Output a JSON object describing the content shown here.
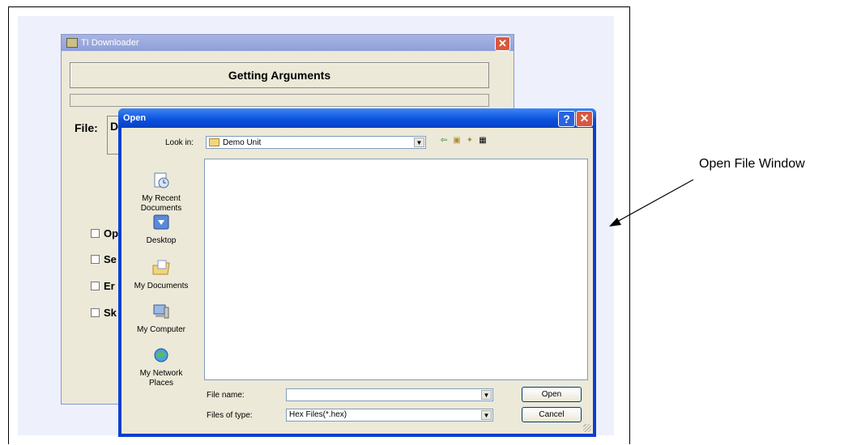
{
  "ti_window": {
    "title": "TI Downloader",
    "heading": "Getting Arguments",
    "file_label": "File:",
    "file_value_partial": "D",
    "close_glyph": "✕",
    "options": [
      "Op",
      "Se",
      "Er",
      "Sk"
    ]
  },
  "open_dialog": {
    "title": "Open",
    "help_glyph": "?",
    "close_glyph": "✕",
    "look_in_label": "Look in:",
    "look_in_value": "Demo Unit",
    "places": [
      {
        "label": "My Recent\nDocuments",
        "icon": "recent-documents-icon"
      },
      {
        "label": "Desktop",
        "icon": "desktop-icon"
      },
      {
        "label": "My Documents",
        "icon": "my-documents-icon"
      },
      {
        "label": "My Computer",
        "icon": "my-computer-icon"
      },
      {
        "label": "My Network\nPlaces",
        "icon": "network-places-icon"
      }
    ],
    "file_name_label": "File name:",
    "file_name_value": "",
    "files_of_type_label": "Files of type:",
    "files_of_type_value": "Hex Files(*.hex)",
    "open_button": "Open",
    "cancel_button": "Cancel"
  },
  "annotation": {
    "label": "Open File Window"
  }
}
